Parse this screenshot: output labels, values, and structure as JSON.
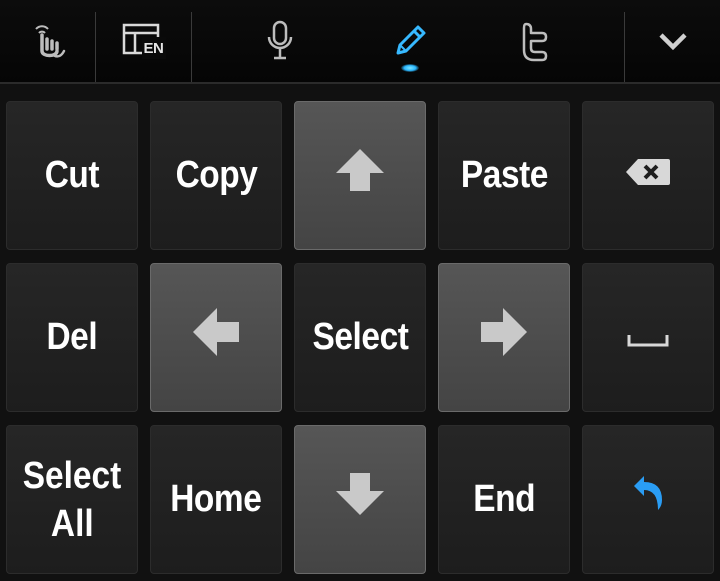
{
  "toolbar": {
    "buttons": [
      {
        "name": "gesture-icon"
      },
      {
        "name": "language-layout-icon",
        "badge": "EN"
      },
      {
        "name": "microphone-icon"
      },
      {
        "name": "pen-edit-icon",
        "active": true
      },
      {
        "name": "twitter-icon"
      },
      {
        "name": "chevron-down-icon"
      }
    ],
    "accent_color": "#2ab4ff"
  },
  "keys": {
    "cut": "Cut",
    "copy": "Copy",
    "up": "up-arrow-icon",
    "paste": "Paste",
    "backspace": "backspace-icon",
    "del": "Del",
    "left": "left-arrow-icon",
    "select": "Select",
    "right": "right-arrow-icon",
    "space": "space-icon",
    "select_all_line1": "Select",
    "select_all_line2": "All",
    "home": "Home",
    "down": "down-arrow-icon",
    "end": "End",
    "undo": "undo-icon"
  },
  "colors": {
    "key_dark": "#222222",
    "key_light": "#4e4e4e",
    "undo_blue": "#2a9df4"
  }
}
